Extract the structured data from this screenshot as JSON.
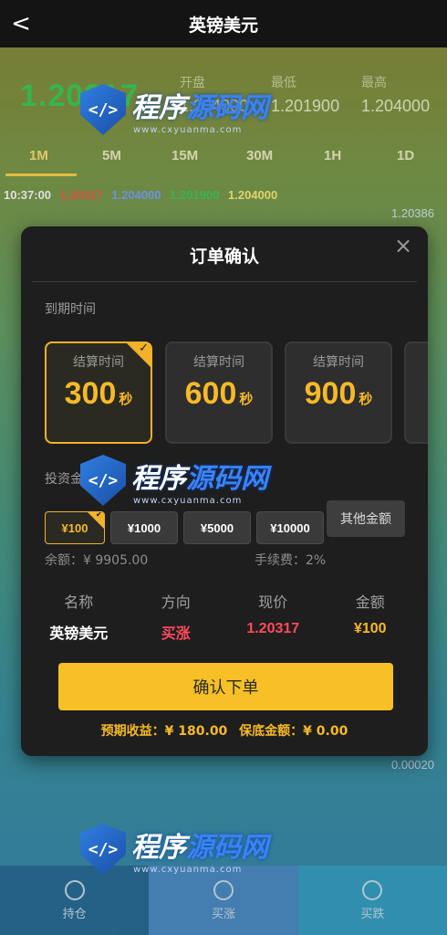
{
  "header": {
    "back": "<",
    "title": "英镑美元"
  },
  "market": {
    "current_price": "1.20317",
    "stats": [
      {
        "label": "开盘",
        "value": "1.204000"
      },
      {
        "label": "最低",
        "value": "1.201900"
      },
      {
        "label": "最高",
        "value": "1.204000"
      }
    ],
    "tabs": [
      "1M",
      "5M",
      "15M",
      "30M",
      "1H",
      "1D"
    ],
    "active_tab": "1M",
    "tick": {
      "time": "10:37:00",
      "current": "1.20317",
      "open": "1.204000",
      "low": "1.201900",
      "high": "1.204000"
    },
    "axis_top": "1.20386",
    "axis_bottom": "0.00020"
  },
  "order": {
    "title": "订单确认",
    "close_icon": "×",
    "expiry_label": "到期时间",
    "durations": [
      {
        "label": "结算时间",
        "value": "300",
        "unit": "秒",
        "selected": true
      },
      {
        "label": "结算时间",
        "value": "600",
        "unit": "秒",
        "selected": false
      },
      {
        "label": "结算时间",
        "value": "900",
        "unit": "秒",
        "selected": false
      }
    ],
    "amount_label": "投资金额",
    "amounts": [
      {
        "label": "¥100",
        "selected": true
      },
      {
        "label": "¥1000",
        "selected": false
      },
      {
        "label": "¥5000",
        "selected": false
      },
      {
        "label": "¥10000",
        "selected": false
      }
    ],
    "other_amount": "其他金额",
    "balance": "余额：¥ 9905.00",
    "fee": "手续费：2%",
    "summary_headers": [
      "名称",
      "方向",
      "现价",
      "金额"
    ],
    "summary": {
      "name": "英镑美元",
      "direction": "买涨",
      "price": "1.20317",
      "amount": "¥100"
    },
    "confirm_label": "确认下单",
    "expected_profit": "预期收益：¥ 180.00",
    "guarantee": "保底金额：¥ 0.00"
  },
  "nav": {
    "items": [
      "持仓",
      "买涨",
      "买跌"
    ]
  },
  "watermark": {
    "text_a": "程序",
    "text_b": "源码网",
    "sub": "www.cxyuanma.com"
  },
  "colors": {
    "accent": "#f6c026",
    "up": "#ff4a5a",
    "price_green": "#3ecf5a"
  }
}
